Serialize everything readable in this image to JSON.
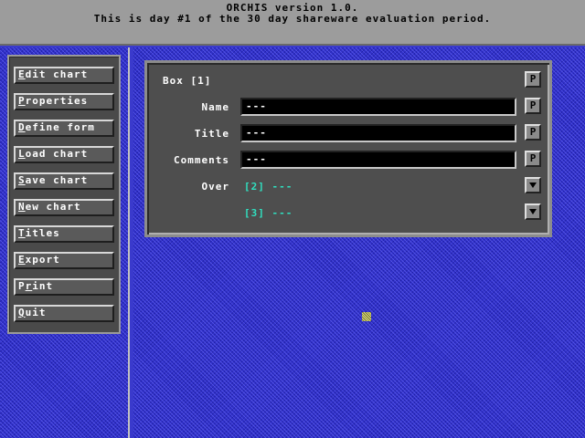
{
  "titlebar": {
    "line1": "ORCHIS version 1.0.",
    "line2": "This is day #1 of the 30 day shareware evaluation period."
  },
  "sidebar": {
    "items": [
      {
        "pre": "",
        "ul": "E",
        "post": "dit chart"
      },
      {
        "pre": "",
        "ul": "P",
        "post": "roperties"
      },
      {
        "pre": "",
        "ul": "D",
        "post": "efine form"
      },
      {
        "pre": "",
        "ul": "L",
        "post": "oad chart"
      },
      {
        "pre": "",
        "ul": "S",
        "post": "ave chart"
      },
      {
        "pre": "",
        "ul": "N",
        "post": "ew chart"
      },
      {
        "pre": "",
        "ul": "T",
        "post": "itles"
      },
      {
        "pre": "",
        "ul": "E",
        "post": "xport"
      },
      {
        "pre": "P",
        "ul": "r",
        "post": "int"
      },
      {
        "pre": "",
        "ul": "Q",
        "post": "uit"
      }
    ]
  },
  "panel": {
    "box_label": "Box [1]",
    "name_label": "Name",
    "name_value": "---",
    "title_label": "Title",
    "title_value": "---",
    "comments_label": "Comments",
    "comments_value": "---",
    "over_label": "Over",
    "over_items": [
      {
        "index": "[2]",
        "value": "---"
      },
      {
        "index": "[3]",
        "value": "---"
      }
    ],
    "p_button": "P",
    "dropdown_icon": "chevron-down-icon"
  },
  "colors": {
    "background": "#3a3acc",
    "panel": "#4e4e4e",
    "titlebar": "#9c9c9c",
    "link": "#30e0c0"
  }
}
